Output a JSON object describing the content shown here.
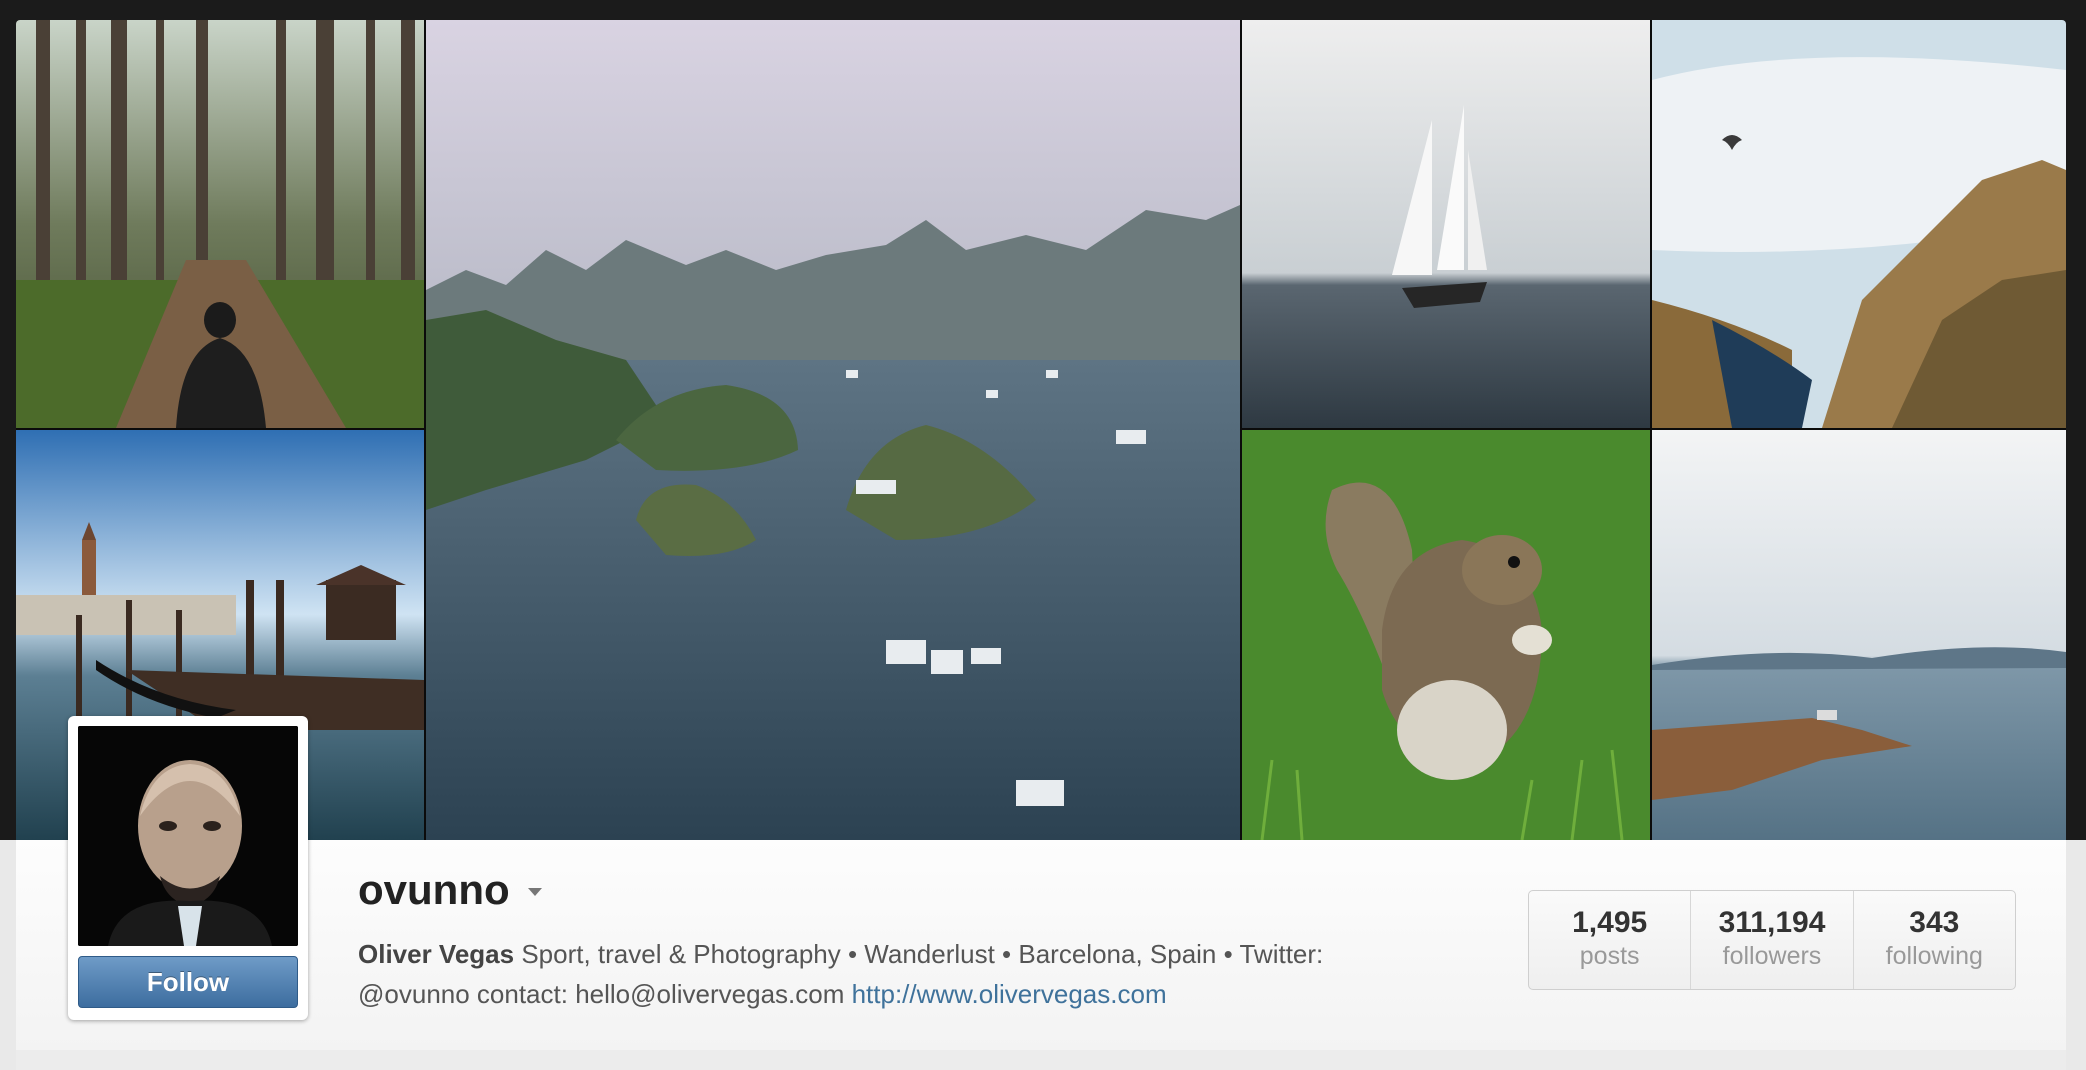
{
  "profile": {
    "username": "ovunno",
    "full_name": "Oliver Vegas",
    "bio_line1": " Sport, travel & Photography • Wanderlust • Barcelona, Spain • Twitter:",
    "bio_line2": "@ovunno contact: hello@olivervegas.com ",
    "website": "http://www.olivervegas.com",
    "follow_label": "Follow"
  },
  "stats": [
    {
      "value": "1,495",
      "label": "posts"
    },
    {
      "value": "311,194",
      "label": "followers"
    },
    {
      "value": "343",
      "label": "following"
    }
  ],
  "colors": {
    "accent_link": "#3f729b",
    "follow_button": "#4a7bad",
    "page_bg": "#1a1a1a"
  },
  "photos": [
    {
      "subject": "forest-path"
    },
    {
      "subject": "bay-islands-boats"
    },
    {
      "subject": "sailboat-fog"
    },
    {
      "subject": "coastal-cliffs-gull"
    },
    {
      "subject": "venice-dock"
    },
    {
      "subject": "squirrel-grass"
    },
    {
      "subject": "lake-misty-shore"
    }
  ]
}
